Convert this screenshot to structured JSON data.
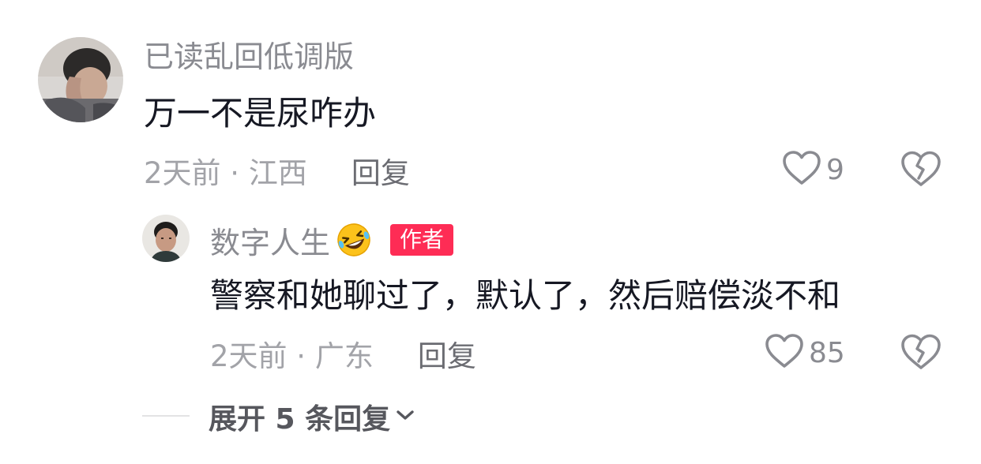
{
  "main_comment": {
    "username": "已读乱回低调版",
    "text": "万一不是尿咋办",
    "time_location": "2天前 · 江西",
    "reply_label": "回复",
    "like_count": "9"
  },
  "reply_comment": {
    "username": "数字人生",
    "author_badge": "作者",
    "text": "警察和她聊过了，默认了，然后赔偿淡不和",
    "time_location": "2天前 · 广东",
    "reply_label": "回复",
    "like_count": "85"
  },
  "expand": {
    "label": "展开 5 条回复"
  },
  "colors": {
    "badge": "#fe2c55",
    "primary_text": "#161823",
    "secondary_text": "#8a8b91"
  },
  "icons": {
    "like": "heart-outline-icon",
    "dislike": "broken-heart-icon",
    "expand": "chevron-down-icon",
    "emoji": "rolling-laughing-emoji"
  }
}
